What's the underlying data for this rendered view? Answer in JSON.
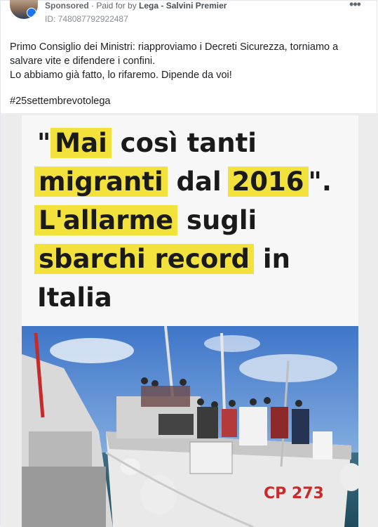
{
  "post": {
    "sponsored": "Sponsored",
    "paid_for": " · Paid for by ",
    "page_name": "Lega - Salvini Premier",
    "ad_id": "ID: 748087792922487",
    "more_icon": "more-horizontal-icon",
    "text_line1": "Primo Consiglio dei Ministri: riapproviamo i Decreti Sicurezza, torniamo a salvare vite e difendere i confini.",
    "text_line2": "Lo abbiamo già fatto, lo rifaremo. Dipende da voi!",
    "hashtag": "#25settembrevotolega"
  },
  "ad": {
    "quote_open": "\"",
    "w1": "Mai",
    "w2": " così tanti",
    "w3": "migranti",
    "w4": " dal ",
    "w5": "2016",
    "w6": "\".",
    "w7": "L'allarme",
    "w8": " sugli",
    "w9": "sbarchi record",
    "w10": " in",
    "w11": "Italia",
    "boat_label": "CP 273",
    "highlight_color": "#f3e13c"
  }
}
